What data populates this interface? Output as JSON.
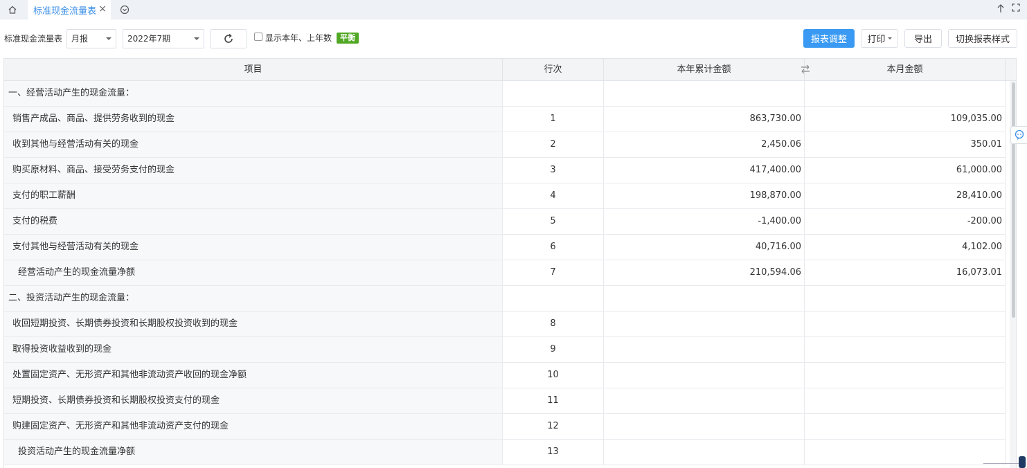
{
  "tabbar": {
    "active_tab": "标准现金流量表",
    "close_glyph": "×"
  },
  "toolbar": {
    "report_label": "标准现金流量表",
    "period_select": "月报",
    "date_select": "2022年7期",
    "show_year_label": "显示本年、上年数",
    "balance_badge": "平衡",
    "adjust_button": "报表调整",
    "print_button": "打印",
    "export_button": "导出",
    "switch_button": "切换报表样式"
  },
  "table": {
    "headers": [
      "项目",
      "行次",
      "本年累计金额",
      "本月金额"
    ],
    "rows": [
      {
        "item": "一、经营活动产生的现金流量：",
        "line": "",
        "ytd": "",
        "month": "",
        "type": "section"
      },
      {
        "item": "销售产成品、商品、提供劳务收到的现金",
        "line": "1",
        "ytd": "863,730.00",
        "month": "109,035.00",
        "type": "item"
      },
      {
        "item": "收到其他与经营活动有关的现金",
        "line": "2",
        "ytd": "2,450.06",
        "month": "350.01",
        "type": "item"
      },
      {
        "item": "购买原材料、商品、接受劳务支付的现金",
        "line": "3",
        "ytd": "417,400.00",
        "month": "61,000.00",
        "type": "item"
      },
      {
        "item": "支付的职工薪酬",
        "line": "4",
        "ytd": "198,870.00",
        "month": "28,410.00",
        "type": "item"
      },
      {
        "item": "支付的税费",
        "line": "5",
        "ytd": "-1,400.00",
        "month": "-200.00",
        "type": "item"
      },
      {
        "item": "支付其他与经营活动有关的现金",
        "line": "6",
        "ytd": "40,716.00",
        "month": "4,102.00",
        "type": "item"
      },
      {
        "item": "经营活动产生的现金流量净额",
        "line": "7",
        "ytd": "210,594.06",
        "month": "16,073.01",
        "type": "indent"
      },
      {
        "item": "二、投资活动产生的现金流量：",
        "line": "",
        "ytd": "",
        "month": "",
        "type": "section"
      },
      {
        "item": "收回短期投资、长期债券投资和长期股权投资收到的现金",
        "line": "8",
        "ytd": "",
        "month": "",
        "type": "item"
      },
      {
        "item": "取得投资收益收到的现金",
        "line": "9",
        "ytd": "",
        "month": "",
        "type": "item"
      },
      {
        "item": "处置固定资产、无形资产和其他非流动资产收回的现金净额",
        "line": "10",
        "ytd": "",
        "month": "",
        "type": "item"
      },
      {
        "item": "短期投资、长期债券投资和长期股权投资支付的现金",
        "line": "11",
        "ytd": "",
        "month": "",
        "type": "item"
      },
      {
        "item": "购建固定资产、无形资产和其他非流动资产支付的现金",
        "line": "12",
        "ytd": "",
        "month": "",
        "type": "item"
      },
      {
        "item": "投资活动产生的现金流量净额",
        "line": "13",
        "ytd": "",
        "month": "",
        "type": "indent"
      }
    ]
  },
  "colors": {
    "accent": "#3a9af3",
    "tab_text": "#3a8ee6",
    "balance_green": "#52a825"
  }
}
